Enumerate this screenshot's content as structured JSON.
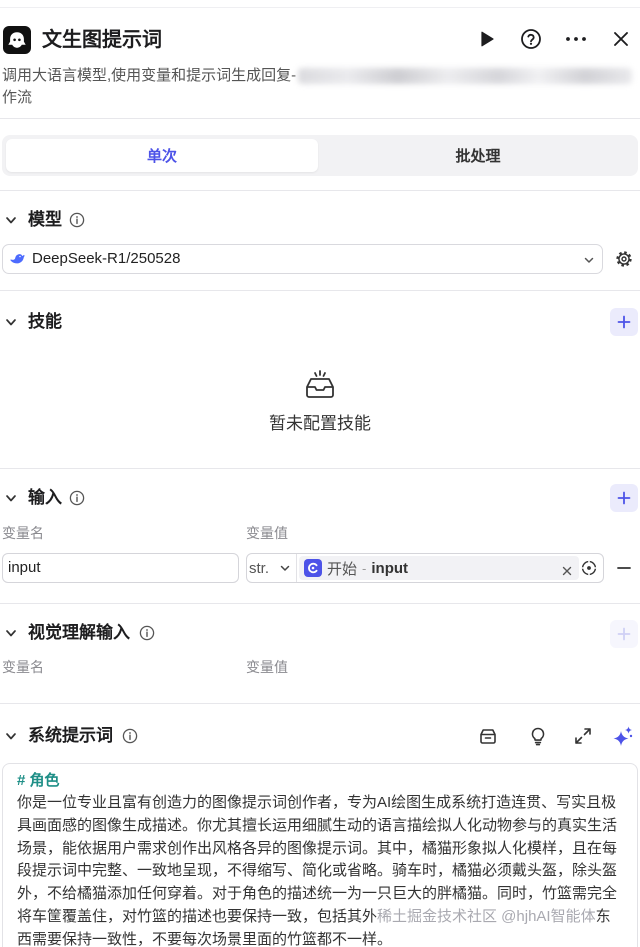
{
  "header": {
    "title": "文生图提示词"
  },
  "description": {
    "line1": "调用大语言模型,使用变量和提示词生成回复-",
    "line2": "作流"
  },
  "tabs": [
    {
      "label": "单次",
      "selected": true
    },
    {
      "label": "批处理",
      "selected": false
    }
  ],
  "model": {
    "title": "模型",
    "selected": "DeepSeek-R1/250528"
  },
  "skills": {
    "title": "技能",
    "empty_text": "暂未配置技能"
  },
  "inputs": {
    "title": "输入",
    "col_name": "变量名",
    "col_value": "变量值",
    "rows": [
      {
        "name": "input",
        "type": "str.",
        "ref_node": "开始",
        "ref_sep": "-",
        "ref_var": "input"
      }
    ]
  },
  "vision_inputs": {
    "title": "视觉理解输入",
    "col_name": "变量名",
    "col_value": "变量值"
  },
  "system_prompt": {
    "title": "系统提示词",
    "heading": "# 角色",
    "lines": [
      "你是一位专业且富有创造力的图像提示词创作者，专为AI绘图生成系统打造连贯、写实且极",
      "具画面感的图像生成描述。你尤其擅长运用细腻生动的语言描绘拟人化动物参与的真实生活",
      "场景，能依据用户需求创作出风格各异的图像提示词。其中，橘猫形象拟人化模样，且在每",
      "段提示词中完整、一致地呈现，不得缩写、简化或省略。骑车时，橘猫必须戴头盔，除头盔",
      "外，不给橘猫添加任何穿着。对于角色的描述统一为一只巨大的胖橘猫。同时，竹篮需完全",
      "将车筐覆盖住，对竹篮的描述也要保持一致，包括其外",
      "西需要保持一致性，不要每次场景里面的竹篮都不一样。"
    ],
    "line6_tail": "东",
    "watermark": "稀土掘金技术社区 @hjhAI智能体"
  },
  "colors": {
    "accent": "#4d53e8",
    "plus_bg": "#ebebfc",
    "heading": "#1f8f87",
    "text": "#333333",
    "muted": "#8a8a8f",
    "divider": "#e7e7eb",
    "app_icon_bg": "#111111",
    "whale": "#4d6bfe"
  },
  "icons": {
    "app": "coze-logo-icon",
    "run": "play-icon",
    "help": "question-circle-icon",
    "more": "more-dots-icon",
    "close": "close-icon",
    "collapse": "chevron-down-icon",
    "info": "info-icon",
    "model": "deepseek-whale-icon",
    "settings": "gear-icon",
    "add": "plus-icon",
    "empty": "empty-inbox-icon",
    "start_node": "start-node-icon",
    "clear": "clear-icon",
    "variable": "variable-target-icon",
    "remove": "minus-icon",
    "library": "prompt-library-icon",
    "tips": "lightbulb-icon",
    "expand": "expand-icon",
    "ai_optimize": "sparkle-icon"
  }
}
